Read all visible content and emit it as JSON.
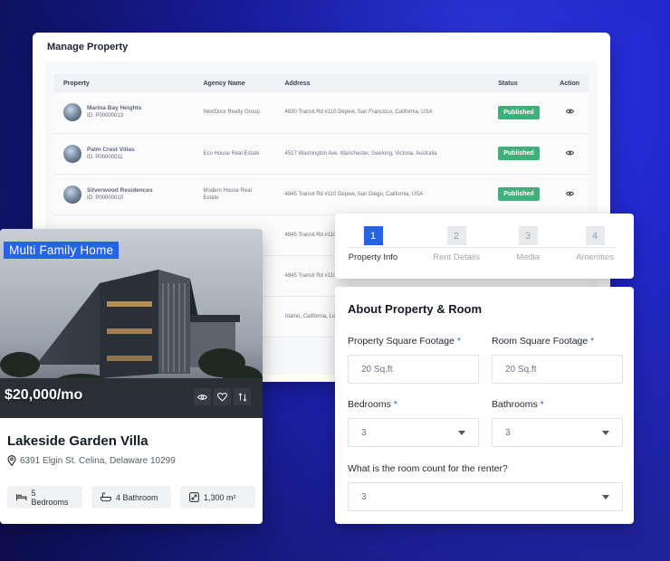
{
  "manage": {
    "title": "Manage Property",
    "columns": [
      "Property",
      "Agency Name",
      "Address",
      "Status",
      "Action"
    ],
    "rows": [
      {
        "name": "Marina Bay Heights",
        "id": "ID: P00000013",
        "agency": "NextDoor Realty Group",
        "address": "4830 Transit Rd #110 Depew, San Francisco, California, USA",
        "status": "Published"
      },
      {
        "name": "Palm Crest Villas",
        "id": "ID: P00000011",
        "agency": "Eco House Real Estate",
        "address": "4517 Washington Ave. Manchester, Geelong, Victoria, Australia",
        "status": "Published"
      },
      {
        "name": "Silverwood Residences",
        "id": "ID: P00000010",
        "agency": "Modern House Real Estate",
        "address": "4845 Transit Rd #110 Depew, San Diego, California, USA",
        "status": "Published"
      },
      {
        "name": "",
        "id": "",
        "agency": "",
        "address": "4845 Transit Rd #110",
        "status": ""
      },
      {
        "name": "",
        "id": "",
        "agency": "",
        "address": "4845 Transit Rd #110",
        "status": ""
      },
      {
        "name": "",
        "id": "",
        "agency": "",
        "address": "Alamo, California, Lo",
        "status": ""
      }
    ]
  },
  "card": {
    "type_tag": "Multi Family Home",
    "price": "$20,000/mo",
    "title": "Lakeside Garden Villa",
    "address": "6391 Elgin St. Celina, Delaware 10299",
    "features": [
      {
        "icon": "bed-icon",
        "label": "5 Bedrooms"
      },
      {
        "icon": "bathtub-icon",
        "label": "4 Bathroom"
      },
      {
        "icon": "area-icon",
        "label": "1,300 m²"
      }
    ]
  },
  "steps": [
    {
      "num": "1",
      "label": "Property Info",
      "active": true
    },
    {
      "num": "2",
      "label": "Rent Details",
      "active": false
    },
    {
      "num": "3",
      "label": "Media",
      "active": false
    },
    {
      "num": "4",
      "label": "Amenities",
      "active": false
    }
  ],
  "form": {
    "title": "About Property & Room",
    "property_sqft": {
      "label": "Property Square Footage",
      "required_mark": "*",
      "value": "20 Sq.ft"
    },
    "room_sqft": {
      "label": "Room Square Footage",
      "required_mark": "*",
      "value": "20 Sq.ft"
    },
    "bedrooms": {
      "label": "Bedrooms",
      "required_mark": "*",
      "value": "3"
    },
    "bathrooms": {
      "label": "Bathrooms",
      "required_mark": "*",
      "value": "3"
    },
    "room_count": {
      "label": "What is the room count for the renter?",
      "value": "3"
    }
  },
  "colors": {
    "accent": "#2563eb",
    "published": "#3fb07a"
  }
}
